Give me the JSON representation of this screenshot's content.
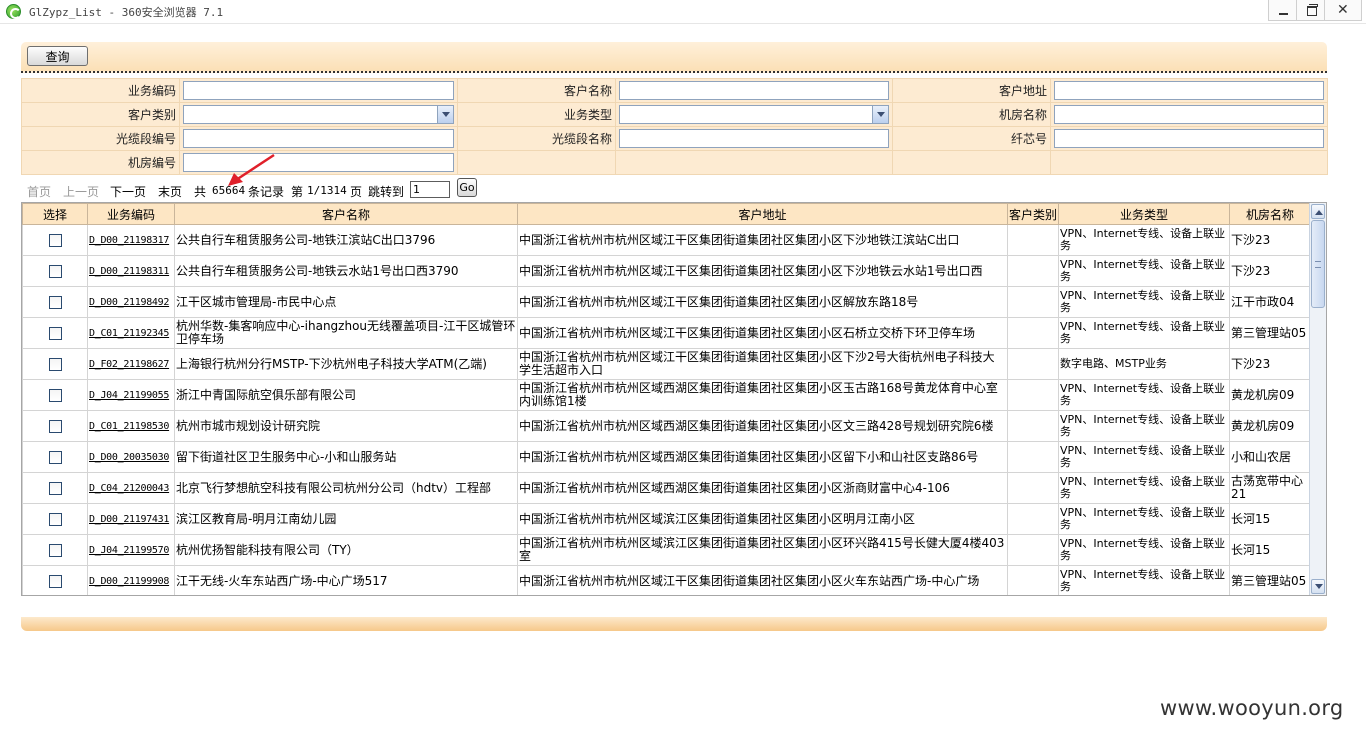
{
  "window": {
    "title": "GlZypz_List - 360安全浏览器 7.1",
    "close_glyph": "✕"
  },
  "query_button": "查询",
  "form": {
    "rows": [
      [
        {
          "label": "业务编码",
          "type": "text",
          "value": ""
        },
        {
          "label": "客户名称",
          "type": "text",
          "value": ""
        },
        {
          "label": "客户地址",
          "type": "text",
          "value": ""
        }
      ],
      [
        {
          "label": "客户类别",
          "type": "select",
          "value": ""
        },
        {
          "label": "业务类型",
          "type": "select",
          "value": ""
        },
        {
          "label": "机房名称",
          "type": "text",
          "value": ""
        }
      ],
      [
        {
          "label": "光缆段编号",
          "type": "text",
          "value": ""
        },
        {
          "label": "光缆段名称",
          "type": "text",
          "value": ""
        },
        {
          "label": "纤芯号",
          "type": "text",
          "value": ""
        }
      ],
      [
        {
          "label": "机房编号",
          "type": "text",
          "value": ""
        }
      ]
    ]
  },
  "pager": {
    "first": "首页",
    "prev": "上一页",
    "next": "下一页",
    "last": "末页",
    "total_prefix": "共",
    "total": "65664",
    "total_suffix": "条记录",
    "page_prefix": "第",
    "page_status": "1/1314",
    "page_suffix": "页",
    "jump_label": "跳转到",
    "jump_value": "1",
    "go_label": "Go"
  },
  "grid": {
    "columns": [
      "选择",
      "业务编码",
      "客户名称",
      "客户地址",
      "客户类别",
      "业务类型",
      "机房名称"
    ],
    "rows": [
      {
        "code": "D_D00_21198317",
        "name": "公共自行车租赁服务公司-地铁江滨站C出口3796",
        "address": "中国浙江省杭州市杭州区域江干区集团街道集团社区集团小区下沙地铁江滨站C出口",
        "category": "",
        "service": "VPN、Internet专线、设备上联业务",
        "room": "下沙23"
      },
      {
        "code": "D_D00_21198311",
        "name": "公共自行车租赁服务公司-地铁云水站1号出口西3790",
        "address": "中国浙江省杭州市杭州区域江干区集团街道集团社区集团小区下沙地铁云水站1号出口西",
        "category": "",
        "service": "VPN、Internet专线、设备上联业务",
        "room": "下沙23"
      },
      {
        "code": "D_D00_21198492",
        "name": "江干区城市管理局-市民中心点",
        "address": "中国浙江省杭州市杭州区域江干区集团街道集团社区集团小区解放东路18号",
        "category": "",
        "service": "VPN、Internet专线、设备上联业务",
        "room": "江干市政04"
      },
      {
        "code": "D_C01_21192345",
        "name": "杭州华数-集客响应中心-ihangzhou无线覆盖项目-江干区城管环卫停车场",
        "address": "中国浙江省杭州市杭州区域江干区集团街道集团社区集团小区石桥立交桥下环卫停车场",
        "category": "",
        "service": "VPN、Internet专线、设备上联业务",
        "room": "第三管理站05"
      },
      {
        "code": "D_F02_21198627",
        "name": "上海银行杭州分行MSTP-下沙杭州电子科技大学ATM(乙端)",
        "address": "中国浙江省杭州市杭州区域江干区集团街道集团社区集团小区下沙2号大街杭州电子科技大学生活超市入口",
        "category": "",
        "service": "数字电路、MSTP业务",
        "room": "下沙23"
      },
      {
        "code": "D_J04_21199055",
        "name": "浙江中青国际航空俱乐部有限公司",
        "address": "中国浙江省杭州市杭州区域西湖区集团街道集团社区集团小区玉古路168号黄龙体育中心室内训练馆1楼",
        "category": "",
        "service": "VPN、Internet专线、设备上联业务",
        "room": "黄龙机房09"
      },
      {
        "code": "D_C01_21198530",
        "name": "杭州市城市规划设计研究院",
        "address": "中国浙江省杭州市杭州区域西湖区集团街道集团社区集团小区文三路428号规划研究院6楼",
        "category": "",
        "service": "VPN、Internet专线、设备上联业务",
        "room": "黄龙机房09"
      },
      {
        "code": "D_D00_20035030",
        "name": "留下街道社区卫生服务中心-小和山服务站",
        "address": "中国浙江省杭州市杭州区域西湖区集团街道集团社区集团小区留下小和山社区支路86号",
        "category": "",
        "service": "VPN、Internet专线、设备上联业务",
        "room": "小和山农居"
      },
      {
        "code": "D_C04_21200043",
        "name": "北京飞行梦想航空科技有限公司杭州分公司（hdtv）工程部",
        "address": "中国浙江省杭州市杭州区域西湖区集团街道集团社区集团小区浙商财富中心4-106",
        "category": "",
        "service": "VPN、Internet专线、设备上联业务",
        "room": "古荡宽带中心21"
      },
      {
        "code": "D_D00_21197431",
        "name": "滨江区教育局-明月江南幼儿园",
        "address": "中国浙江省杭州市杭州区域滨江区集团街道集团社区集团小区明月江南小区",
        "category": "",
        "service": "VPN、Internet专线、设备上联业务",
        "room": "长河15"
      },
      {
        "code": "D_J04_21199570",
        "name": "杭州优扬智能科技有限公司（TY）",
        "address": "中国浙江省杭州市杭州区域滨江区集团街道集团社区集团小区环兴路415号长健大厦4楼403室",
        "category": "",
        "service": "VPN、Internet专线、设备上联业务",
        "room": "长河15"
      },
      {
        "code": "D_D00_21199908",
        "name": "江干无线-火车东站西广场-中心广场517",
        "address": "中国浙江省杭州市杭州区域江干区集团街道集团社区集团小区火车东站西广场-中心广场",
        "category": "",
        "service": "VPN、Internet专线、设备上联业务",
        "room": "第三管理站05"
      }
    ]
  },
  "watermark": "www.wooyun.org",
  "colors": {
    "band": "#fbe0b6",
    "form_cell": "#fdebd2",
    "header_cell": "#fde6c4",
    "annotation_arrow": "#e0202a"
  }
}
